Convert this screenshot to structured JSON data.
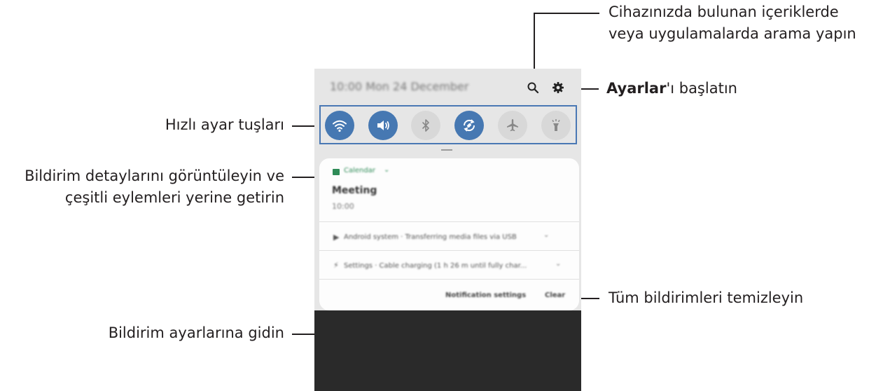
{
  "callouts": {
    "search": {
      "line1": "Cihazınızda bulunan içeriklerde",
      "line2": "veya uygulamalarda arama yapın"
    },
    "settings": {
      "bold": "Ayarlar",
      "rest": "'ı başlatın"
    },
    "quick_settings": "Hızlı ayar tuşları",
    "notification_details": {
      "line1": "Bildirim detaylarını görüntüleyin ve",
      "line2": "çeşitli eylemleri yerine getirin"
    },
    "clear_all": "Tüm bildirimleri temizleyin",
    "notification_settings": "Bildirim ayarlarına gidin"
  },
  "phone": {
    "status_text": "10:00  Mon 24 December",
    "quick_buttons": [
      {
        "icon": "wifi-icon",
        "state": "on"
      },
      {
        "icon": "sound-icon",
        "state": "on"
      },
      {
        "icon": "bluetooth-icon",
        "state": "off"
      },
      {
        "icon": "auto-rotate-icon",
        "state": "on"
      },
      {
        "icon": "airplane-icon",
        "state": "off"
      },
      {
        "icon": "flashlight-icon",
        "state": "off"
      }
    ],
    "notifications": {
      "calendar_app": "Calendar",
      "meeting_title": "Meeting",
      "meeting_time": "10:00",
      "android_row": "Android system · Transferring media files via USB",
      "settings_row": "Settings · Cable charging (1 h 26 m until fully char...",
      "notification_settings_button": "Notification settings",
      "clear_button": "Clear"
    }
  },
  "colors": {
    "accent": "#4678b2",
    "highlight_border": "#4a78b4",
    "panel_bg": "#e6e6e6",
    "screen_dark": "#2a2a2a"
  }
}
